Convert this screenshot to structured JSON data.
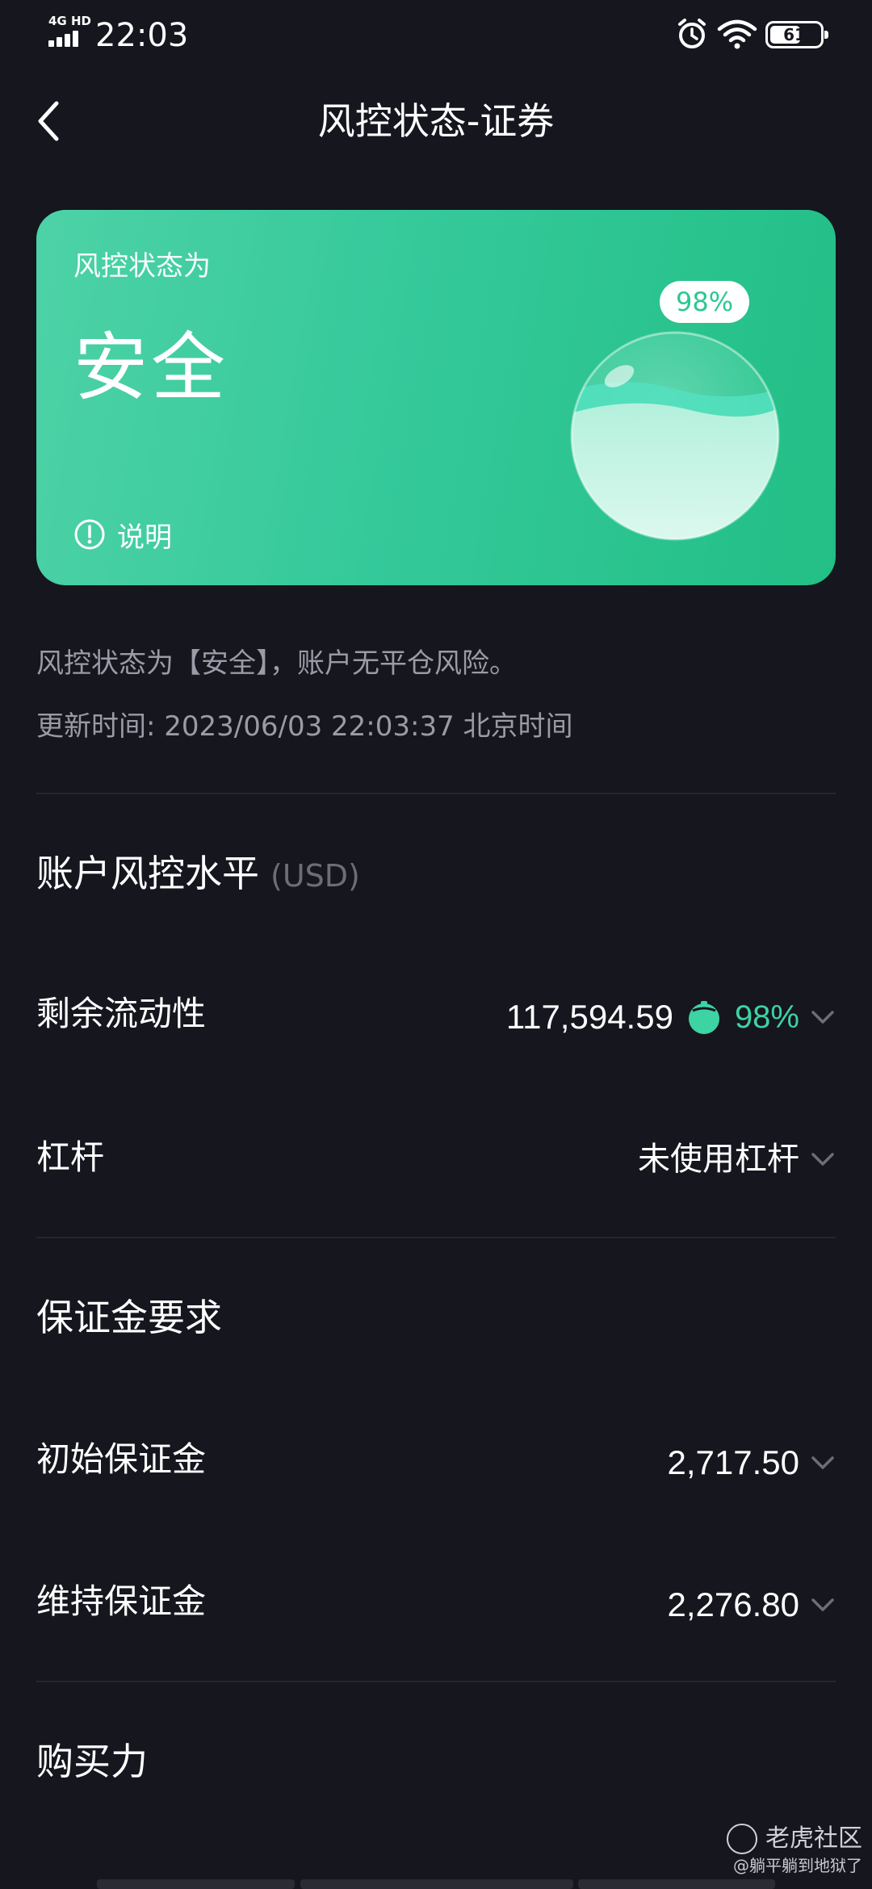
{
  "status_bar": {
    "network": "4G HD",
    "time": "22:03",
    "battery": "61"
  },
  "nav": {
    "title": "风控状态-证券"
  },
  "card": {
    "subtitle": "风控状态为",
    "status": "安全",
    "info_label": "说明",
    "percent": "98%",
    "fill_level": 0.98,
    "colors": {
      "start": "#4dd2a6",
      "end": "#22bf86"
    }
  },
  "description": {
    "message": "风控状态为【安全】，账户无平仓风险。",
    "update_time": "更新时间: 2023/06/03 22:03:37 北京时间"
  },
  "account_level": {
    "title": "账户风控水平",
    "unit": "(USD)",
    "rows": [
      {
        "label": "剩余流动性",
        "value": "117,594.59",
        "percent": "98%"
      },
      {
        "label": "杠杆",
        "value": "未使用杠杆"
      }
    ]
  },
  "margin": {
    "title": "保证金要求",
    "rows": [
      {
        "label": "初始保证金",
        "value": "2,717.50"
      },
      {
        "label": "维持保证金",
        "value": "2,276.80"
      }
    ]
  },
  "buying_power": {
    "title": "购买力"
  },
  "watermark": {
    "brand": "老虎社区",
    "user": "@躺平躺到地狱了"
  },
  "accent_color": "#3ed3a3"
}
